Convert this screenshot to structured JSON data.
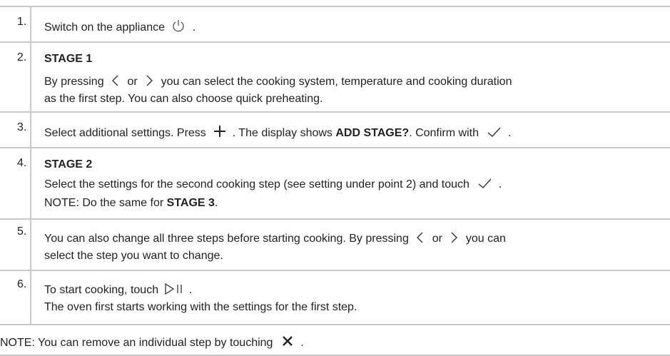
{
  "steps": [
    {
      "num": "1.",
      "text_before": "Switch on the appliance",
      "text_after": "."
    },
    {
      "num": "2.",
      "title": "STAGE 1",
      "line1_a": "By pressing",
      "line1_or": "or",
      "line1_b": "you can select the cooking system, temperature and cooking duration",
      "line2": "as the first step. You can also choose quick preheating."
    },
    {
      "num": "3.",
      "a": "Select additional settings. Press",
      "b": ". The display shows",
      "bold": "ADD STAGE?",
      "c": ". Confirm with",
      "d": "."
    },
    {
      "num": "4.",
      "title": "STAGE 2",
      "line1": "Select the settings for the second cooking step (see setting under point 2) and touch",
      "line1_end": ".",
      "note_a": "NOTE: Do the same for",
      "note_bold": "STAGE 3",
      "note_end": "."
    },
    {
      "num": "5.",
      "line1_a": "You can also change all three steps before starting cooking. By pressing",
      "line1_or": "or",
      "line1_b": "you can",
      "line2": "select the step you want to change."
    },
    {
      "num": "6.",
      "line1_a": "To start cooking, touch",
      "line1_end": ".",
      "line2": "The oven first starts working with the settings for the first step."
    }
  ],
  "footer": {
    "a": "NOTE: You can remove an individual step by touching",
    "b": "."
  },
  "icons": [
    "power-icon",
    "chevron-left-icon",
    "chevron-right-icon",
    "plus-icon",
    "checkmark-icon",
    "play-pause-icon",
    "close-icon"
  ],
  "colors": {
    "border": "#c9c9c9",
    "text": "#222222"
  }
}
